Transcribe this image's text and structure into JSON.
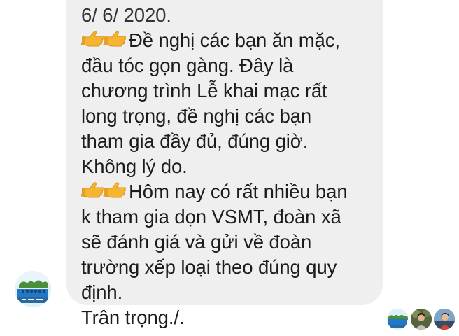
{
  "message": {
    "lines": [
      {
        "prefix_emoji": false,
        "text": "6/ 6/ 2020."
      },
      {
        "prefix_emoji": true,
        "text": "Đề nghị các bạn ăn mặc,"
      },
      {
        "prefix_emoji": false,
        "text": "đầu tóc gọn gàng. Đây là"
      },
      {
        "prefix_emoji": false,
        "text": "chương trình Lễ khai mạc rất"
      },
      {
        "prefix_emoji": false,
        "text": "long trọng, đề nghị các bạn"
      },
      {
        "prefix_emoji": false,
        "text": "tham gia đầy đủ, đúng giờ."
      },
      {
        "prefix_emoji": false,
        "text": "Không lý do."
      },
      {
        "prefix_emoji": true,
        "text": "Hôm nay có rất nhiều bạn"
      },
      {
        "prefix_emoji": false,
        "text": "k tham gia dọn VSMT, đoàn xã"
      },
      {
        "prefix_emoji": false,
        "text": "sẽ đánh giá và gửi về đoàn"
      },
      {
        "prefix_emoji": false,
        "text": "trường xếp loại theo đúng quy"
      },
      {
        "prefix_emoji": false,
        "text": "định."
      },
      {
        "prefix_emoji": false,
        "text": "Trân trọng./."
      }
    ],
    "emoji_icon": "backhand-index-pointing-right-icon",
    "bubble_color": "#efefef",
    "text_color": "#1c1c1c"
  },
  "sender": {
    "avatar_icon": "group-photo-avatar"
  },
  "seen_by": [
    {
      "avatar_icon": "group-photo-avatar"
    },
    {
      "avatar_icon": "person-photo-avatar"
    },
    {
      "avatar_icon": "person-photo-avatar"
    }
  ]
}
